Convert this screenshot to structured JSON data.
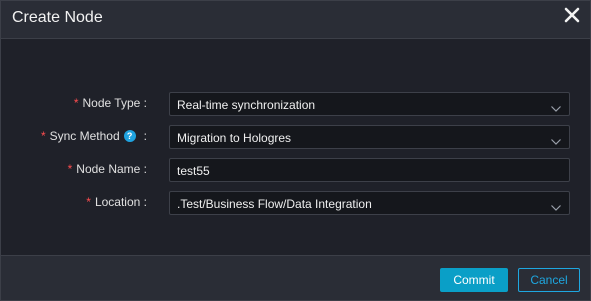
{
  "dialog": {
    "title": "Create Node",
    "fields": [
      {
        "label": "Node Type :",
        "value": "Real-time synchronization",
        "type": "select"
      },
      {
        "label": "Sync Method",
        "colon": ":",
        "value": "Migration to Hologres",
        "type": "select",
        "help": "?"
      },
      {
        "label": "Node Name :",
        "value": "test55",
        "type": "input"
      },
      {
        "label": "Location :",
        "value": ".Test/Business Flow/Data Integration",
        "type": "select"
      }
    ],
    "required_mark": "*",
    "commit_label": "Commit",
    "cancel_label": "Cancel"
  },
  "colors": {
    "accent": "#0a9fc7",
    "required": "#ff4d4f",
    "help": "#1fa3e0"
  }
}
